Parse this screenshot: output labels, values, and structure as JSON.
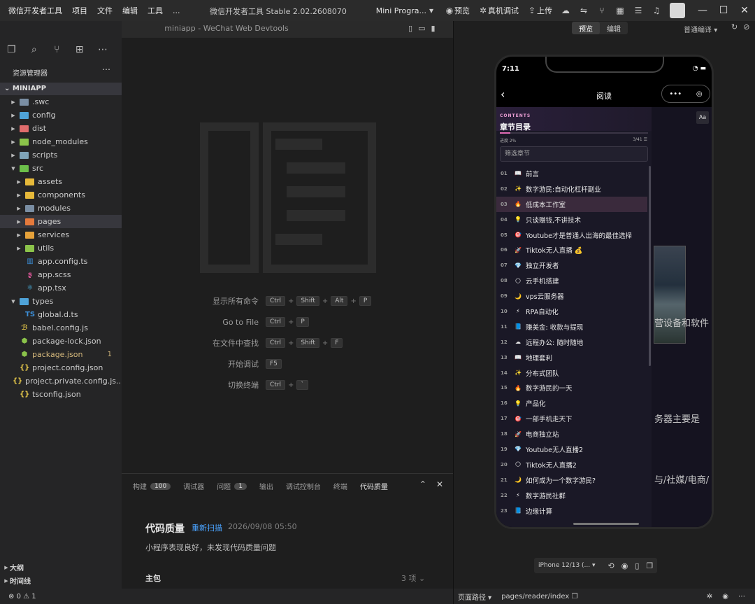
{
  "menu": [
    "微信开发者工具",
    "项目",
    "文件",
    "编辑",
    "工具",
    "..."
  ],
  "app_title": "微信开发者工具 Stable 2.02.2608070",
  "toolbar": {
    "mode": "Mini Progra...",
    "preview": "预览",
    "real_debug": "真机调试",
    "upload": "上传"
  },
  "editor": {
    "title": "miniapp - WeChat Web Devtools"
  },
  "explorer": {
    "title": "资源管理器",
    "project": "MINIAPP",
    "items": [
      {
        "label": ".swc",
        "depth": 0,
        "folder": true,
        "color": "#7a8ea3"
      },
      {
        "label": "config",
        "depth": 0,
        "folder": true,
        "color": "#4fa3d8"
      },
      {
        "label": "dist",
        "depth": 0,
        "folder": true,
        "color": "#e06c6c"
      },
      {
        "label": "node_modules",
        "depth": 0,
        "folder": true,
        "color": "#8bc34a"
      },
      {
        "label": "scripts",
        "depth": 0,
        "folder": true,
        "color": "#7fa4b8"
      },
      {
        "label": "src",
        "depth": 0,
        "folder": true,
        "open": true,
        "color": "#6cc04a"
      },
      {
        "label": "assets",
        "depth": 1,
        "folder": true,
        "color": "#e6b93a"
      },
      {
        "label": "components",
        "depth": 1,
        "folder": true,
        "color": "#e6b93a"
      },
      {
        "label": "modules",
        "depth": 1,
        "folder": true,
        "color": "#7a8ea3"
      },
      {
        "label": "pages",
        "depth": 1,
        "folder": true,
        "color": "#e57a3c",
        "selected": true
      },
      {
        "label": "services",
        "depth": 1,
        "folder": true,
        "color": "#e6a23a"
      },
      {
        "label": "utils",
        "depth": 1,
        "folder": true,
        "color": "#8bc34a"
      },
      {
        "label": "app.config.ts",
        "depth": 1,
        "folder": false,
        "icon": "▥",
        "color": "#3c8fd8"
      },
      {
        "label": "app.scss",
        "depth": 1,
        "folder": false,
        "icon": "ʂ",
        "color": "#e0579a"
      },
      {
        "label": "app.tsx",
        "depth": 1,
        "folder": false,
        "icon": "⚛",
        "color": "#4fc3f7"
      },
      {
        "label": "types",
        "depth": 0,
        "folder": true,
        "open": true,
        "color": "#4fa3d8"
      },
      {
        "label": "global.d.ts",
        "depth": 1,
        "folder": false,
        "icon": "TS",
        "color": "#3c8fd8"
      },
      {
        "label": "babel.config.js",
        "depth": 0,
        "folder": false,
        "icon": "ℬ",
        "color": "#e6c84a"
      },
      {
        "label": "package-lock.json",
        "depth": 0,
        "folder": false,
        "icon": "⬢",
        "color": "#8bc34a"
      },
      {
        "label": "package.json",
        "depth": 0,
        "folder": false,
        "icon": "⬢",
        "color": "#8bc34a",
        "modified": "1",
        "yellow": true
      },
      {
        "label": "project.config.json",
        "depth": 0,
        "folder": false,
        "icon": "{}",
        "color": "#e6c84a"
      },
      {
        "label": "project.private.config.js...",
        "depth": 0,
        "folder": false,
        "icon": "{}",
        "color": "#e6c84a"
      },
      {
        "label": "tsconfig.json",
        "depth": 0,
        "folder": false,
        "icon": "{}",
        "color": "#e6c84a"
      }
    ],
    "outline": "大纲",
    "timeline": "时间线"
  },
  "shortcuts": [
    {
      "label": "显示所有命令",
      "keys": [
        "Ctrl",
        "Shift",
        "Alt",
        "P"
      ]
    },
    {
      "label": "Go to File",
      "keys": [
        "Ctrl",
        "P"
      ]
    },
    {
      "label": "在文件中查找",
      "keys": [
        "Ctrl",
        "Shift",
        "F"
      ]
    },
    {
      "label": "开始调试",
      "keys": [
        "F5"
      ]
    },
    {
      "label": "切换终端",
      "keys": [
        "Ctrl",
        "`"
      ]
    }
  ],
  "panel": {
    "tabs": [
      {
        "label": "构建",
        "badge": "100"
      },
      {
        "label": "调试器"
      },
      {
        "label": "问题",
        "badge": "1"
      },
      {
        "label": "输出"
      },
      {
        "label": "调试控制台"
      },
      {
        "label": "终端"
      },
      {
        "label": "代码质量",
        "active": true
      }
    ],
    "title": "代码质量",
    "rescan": "重新扫描",
    "time": "2026/09/08 05:50",
    "desc": "小程序表现良好，未发现代码质量问题",
    "main_pkg": "主包",
    "count": "3 项"
  },
  "status": {
    "errors": "0",
    "warnings": "1"
  },
  "simulator": {
    "toggle": [
      "预览",
      "编辑"
    ],
    "compile": "普通编译",
    "time": "7:11",
    "nav_title": "阅读",
    "toc": {
      "contents": "CONTENTS",
      "title": "章节目录",
      "progress": "进度 2%",
      "count": "3/41",
      "filter": "筛选章节",
      "chapters": [
        {
          "num": "01",
          "icon": "📖",
          "title": "前言"
        },
        {
          "num": "02",
          "icon": "✨",
          "title": "数字游民:自动化杠杆副业"
        },
        {
          "num": "03",
          "icon": "🔥",
          "title": "低成本工作室",
          "current": true
        },
        {
          "num": "04",
          "icon": "💡",
          "title": "只谈赚钱,不讲技术"
        },
        {
          "num": "05",
          "icon": "🎯",
          "title": "Youtube才是普通人出海的最佳选择"
        },
        {
          "num": "06",
          "icon": "🚀",
          "title": "Tiktok无人直播 💰"
        },
        {
          "num": "07",
          "icon": "💎",
          "title": "独立开发者"
        },
        {
          "num": "08",
          "icon": "🌕",
          "title": "云手机搭建"
        },
        {
          "num": "09",
          "icon": "🌙",
          "title": "vps云服务器"
        },
        {
          "num": "10",
          "icon": "⚡",
          "title": "RPA自动化"
        },
        {
          "num": "11",
          "icon": "📘",
          "title": "赚美金: 收款与提现"
        },
        {
          "num": "12",
          "icon": "☁",
          "title": "远程办公: 随时随地"
        },
        {
          "num": "13",
          "icon": "📖",
          "title": "地理套利"
        },
        {
          "num": "14",
          "icon": "✨",
          "title": "分布式团队"
        },
        {
          "num": "15",
          "icon": "🔥",
          "title": "数字游民的一天"
        },
        {
          "num": "16",
          "icon": "💡",
          "title": "产品化"
        },
        {
          "num": "17",
          "icon": "🎯",
          "title": "一部手机走天下"
        },
        {
          "num": "18",
          "icon": "🚀",
          "title": "电商独立站"
        },
        {
          "num": "19",
          "icon": "💎",
          "title": "Youtube无人直播2"
        },
        {
          "num": "20",
          "icon": "🌕",
          "title": "Tiktok无人直播2"
        },
        {
          "num": "21",
          "icon": "🌙",
          "title": "如何成为一个数字游民?"
        },
        {
          "num": "22",
          "icon": "⚡",
          "title": "数字游民社群"
        },
        {
          "num": "23",
          "icon": "📘",
          "title": "边缘计算"
        }
      ]
    },
    "reader_text": [
      "营设备和软件",
      "务器主要是",
      "与/社媒/电商/"
    ],
    "device": "iPhone 12/13 (..."
  },
  "sim_status": {
    "path_label": "页面路径",
    "path": "pages/reader/index"
  }
}
